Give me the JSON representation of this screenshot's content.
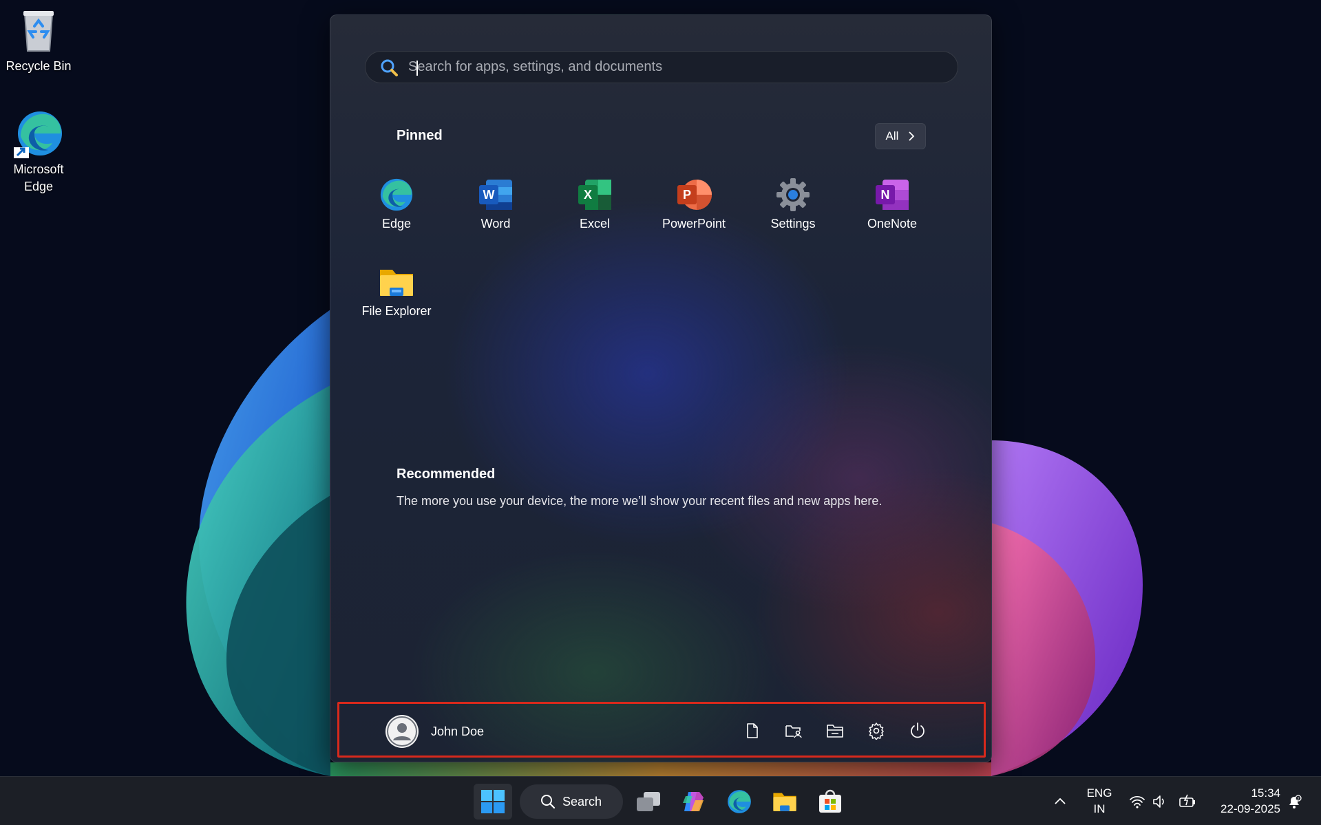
{
  "desktop": {
    "icons": [
      {
        "label": "Recycle Bin",
        "icon": "recycle-bin-icon"
      },
      {
        "label": "Microsoft Edge",
        "icon": "edge-icon"
      }
    ]
  },
  "start_menu": {
    "search": {
      "placeholder": "Search for apps, settings, and documents",
      "value": ""
    },
    "pinned": {
      "title": "Pinned",
      "all_label": "All",
      "apps": [
        {
          "label": "Edge",
          "icon": "edge-icon"
        },
        {
          "label": "Word",
          "icon": "word-icon"
        },
        {
          "label": "Excel",
          "icon": "excel-icon"
        },
        {
          "label": "PowerPoint",
          "icon": "powerpoint-icon"
        },
        {
          "label": "Settings",
          "icon": "settings-icon"
        },
        {
          "label": "OneNote",
          "icon": "onenote-icon"
        },
        {
          "label": "File Explorer",
          "icon": "file-explorer-icon"
        }
      ]
    },
    "recommended": {
      "title": "Recommended",
      "empty_text": "The more you use your device, the more we’ll show your recent files and new apps here."
    },
    "footer": {
      "user_name": "John Doe",
      "buttons": [
        "documents-icon",
        "user-folder-icon",
        "file-explorer-folder-icon",
        "settings-gear-icon",
        "power-icon"
      ]
    }
  },
  "taskbar": {
    "search_label": "Search",
    "apps": [
      "start-icon",
      "task-view-icon",
      "copilot-icon",
      "edge-icon",
      "file-explorer-icon",
      "store-icon"
    ],
    "tray": {
      "language_line1": "ENG",
      "language_line2": "IN",
      "time": "15:34",
      "date": "22-09-2025"
    }
  },
  "colors": {
    "highlight_border": "#d9291c",
    "word": "#185abd",
    "excel": "#107c41",
    "powerpoint": "#c43e1c",
    "onenote": "#7719aa"
  }
}
